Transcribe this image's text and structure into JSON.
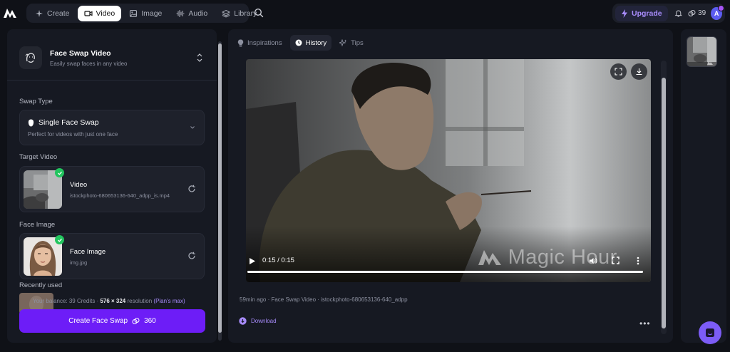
{
  "nav": {
    "items": [
      {
        "label": "Create",
        "icon": "sparkle-icon",
        "active": false
      },
      {
        "label": "Video",
        "icon": "video-icon",
        "active": true
      },
      {
        "label": "Image",
        "icon": "image-icon",
        "active": false
      },
      {
        "label": "Audio",
        "icon": "audio-wave-icon",
        "active": false
      },
      {
        "label": "Library",
        "icon": "stack-icon",
        "active": false
      }
    ]
  },
  "header": {
    "upgrade_label": "Upgrade",
    "credits": "39",
    "avatar_initial": "A"
  },
  "tool": {
    "title": "Face Swap Video",
    "subtitle": "Easily swap faces in any video"
  },
  "swap_type": {
    "label": "Swap Type",
    "selected": "Single Face Swap",
    "description": "Perfect for videos with just one face"
  },
  "target_video": {
    "label": "Target Video",
    "title": "Video",
    "filename": "istockphoto-680653136-640_adpp_is.mp4"
  },
  "face_image": {
    "label": "Face Image",
    "title": "Face Image",
    "filename": "img.jpg"
  },
  "recent": {
    "label": "Recently used"
  },
  "balance": {
    "prefix": "Your balance: 39 Credits",
    "resolution": "576 × 324",
    "resolution_suffix": "resolution",
    "plan_max": "(Plan's max)"
  },
  "create_button": {
    "label": "Create Face Swap",
    "cost": "360"
  },
  "tabs": [
    {
      "label": "Inspirations",
      "icon": "lightbulb-icon",
      "active": false
    },
    {
      "label": "History",
      "icon": "clock-icon",
      "active": true
    },
    {
      "label": "Tips",
      "icon": "sparkles-icon",
      "active": false
    }
  ],
  "video": {
    "time": "0:15 / 0:15",
    "progress": 1.0,
    "watermark": "Magic Hour"
  },
  "history_item": {
    "meta": "59min ago · Face Swap Video · istockphoto-680653136-640_adpp",
    "download_label": "Download",
    "more": "•••"
  },
  "colors": {
    "accent": "#6d1df7",
    "link": "#a78bfa",
    "success": "#22c55e",
    "bg": "#0f1117",
    "panel": "#161922"
  }
}
